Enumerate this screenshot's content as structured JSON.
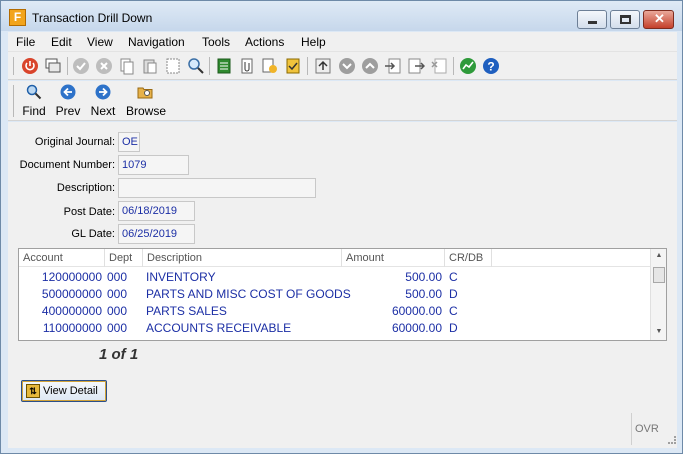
{
  "window": {
    "title": "Transaction Drill Down",
    "app_icon_letter": "F"
  },
  "menu": [
    "File",
    "Edit",
    "View",
    "Navigation",
    "Tools",
    "Actions",
    "Help"
  ],
  "toolbar_icons": [
    "power-icon",
    "copy-window-icon",
    "check-icon",
    "cancel-icon",
    "duplicate-icon",
    "paste-icon",
    "page-icon",
    "zoom-icon",
    "notes-icon",
    "attach-icon",
    "export-icon",
    "checklist-icon",
    "upload-icon",
    "chevron-down-circle-icon",
    "chevron-up-circle-icon",
    "import-icon",
    "export-doc-icon",
    "delete-doc-icon",
    "chart-icon",
    "help-icon"
  ],
  "nav": {
    "find": "Find",
    "prev": "Prev",
    "next": "Next",
    "browse": "Browse"
  },
  "form": {
    "original_journal": {
      "label": "Original Journal:",
      "value": "OE"
    },
    "document_number": {
      "label": "Document Number:",
      "value": "1079"
    },
    "description": {
      "label": "Description:",
      "value": ""
    },
    "post_date": {
      "label": "Post Date:",
      "value": "06/18/2019"
    },
    "gl_date": {
      "label": "GL Date:",
      "value": "06/25/2019"
    }
  },
  "grid": {
    "columns": [
      "Account",
      "Dept",
      "Description",
      "Amount",
      "CR/DB"
    ],
    "rows": [
      {
        "account": "120000000",
        "dept": "000",
        "description": "INVENTORY",
        "amount": "500.00",
        "crdb": "C"
      },
      {
        "account": "500000000",
        "dept": "000",
        "description": "PARTS AND MISC COST OF GOODS",
        "amount": "500.00",
        "crdb": "D"
      },
      {
        "account": "400000000",
        "dept": "000",
        "description": "PARTS SALES",
        "amount": "60000.00",
        "crdb": "C"
      },
      {
        "account": "110000000",
        "dept": "000",
        "description": "ACCOUNTS RECEIVABLE",
        "amount": "60000.00",
        "crdb": "D"
      }
    ]
  },
  "page_indicator": "1 of 1",
  "view_detail": "View Detail",
  "status": {
    "mode": "OVR"
  },
  "colors": {
    "value_text": "#1c2fa5",
    "title_bg": "#c6d7eb",
    "close_button": "#c5402b"
  }
}
